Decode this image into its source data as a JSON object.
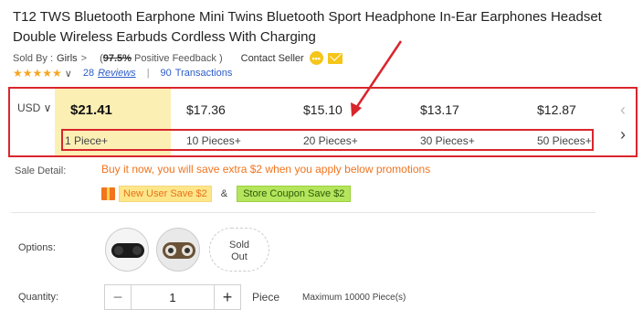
{
  "product": {
    "title": "T12 TWS Bluetooth Earphone Mini Twins Bluetooth Sport Headphone In-Ear Earphones Headset Double Wireless Earbuds Cordless With Charging"
  },
  "seller": {
    "label": "Sold By :",
    "store": "Girls",
    "feedback_open": "(",
    "feedback_pct": "97.5%",
    "feedback_text": "Positive Feedback )",
    "contact": "Contact Seller"
  },
  "rating": {
    "stars": "★★★★★",
    "reviews_count": "28",
    "reviews_label": "Reviews",
    "separator": "|",
    "transactions_count": "90",
    "transactions_label": "Transactions"
  },
  "pricing": {
    "currency": "USD ∨",
    "tiers": [
      {
        "price": "$21.41",
        "qty": "1 Piece+"
      },
      {
        "price": "$17.36",
        "qty": "10 Pieces+"
      },
      {
        "price": "$15.10",
        "qty": "20 Pieces+"
      },
      {
        "price": "$13.17",
        "qty": "30 Pieces+"
      },
      {
        "price": "$12.87",
        "qty": "50 Pieces+"
      }
    ],
    "prev_arrow": "‹",
    "next_arrow": "›"
  },
  "sale": {
    "label": "Sale Detail:",
    "promo_text": "Buy it now, you will save extra $2 when you apply below promotions",
    "new_user_coupon": "New User Save $2",
    "amp": "&",
    "store_coupon": "Store Coupon Save $2"
  },
  "options": {
    "label": "Options:",
    "sold_out_line1": "Sold",
    "sold_out_line2": "Out"
  },
  "quantity": {
    "label": "Quantity:",
    "minus": "−",
    "value": "1",
    "plus": "+",
    "unit": "Piece",
    "max": "Maximum 10000 Piece(s)"
  },
  "colors": {
    "highlight": "#d9262c",
    "accent": "#f2741f",
    "link": "#2b5cc5",
    "star": "#f5a623"
  }
}
